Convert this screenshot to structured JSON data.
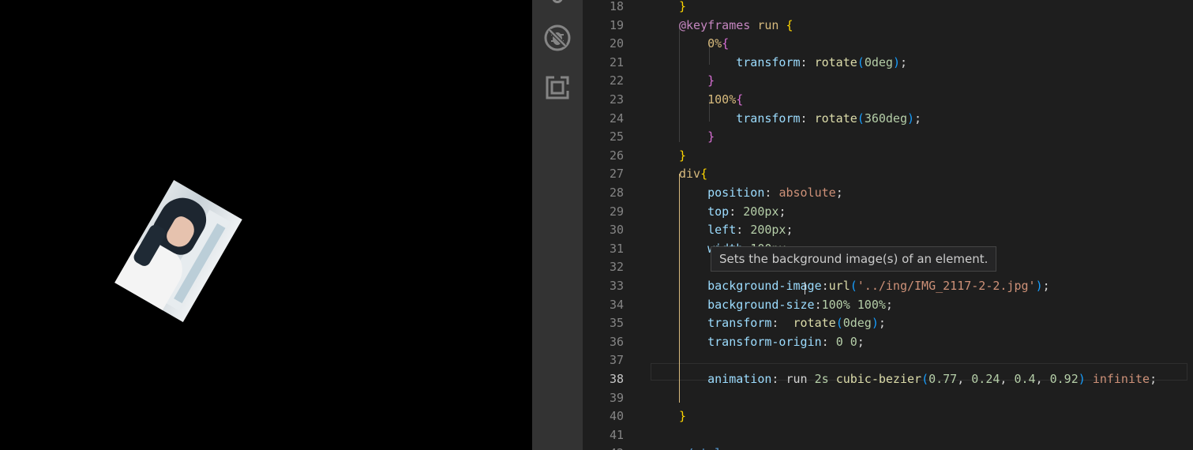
{
  "preview": {
    "image_rotation_deg": 30
  },
  "activity_bar": {
    "icons": [
      "debug-disabled-icon",
      "remote-explorer-icon"
    ]
  },
  "editor": {
    "current_line": 38,
    "lines": [
      {
        "n": "18",
        "tokens": [
          [
            "t-brace1",
            "}"
          ]
        ]
      },
      {
        "n": "19",
        "tokens": [
          [
            "t-kw",
            "@keyframes"
          ],
          [
            "t-plain",
            " "
          ],
          [
            "t-sel",
            "run"
          ],
          [
            "t-plain",
            " "
          ],
          [
            "t-brace1",
            "{"
          ]
        ]
      },
      {
        "n": "20",
        "tokens": [
          [
            "t-plain",
            "    "
          ],
          [
            "t-sel",
            "0%"
          ],
          [
            "t-brace2",
            "{"
          ]
        ]
      },
      {
        "n": "21",
        "tokens": [
          [
            "t-plain",
            "        "
          ],
          [
            "t-prop",
            "transform"
          ],
          [
            "t-plain",
            ": "
          ],
          [
            "t-fn",
            "rotate"
          ],
          [
            "t-brace3",
            "("
          ],
          [
            "t-num",
            "0deg"
          ],
          [
            "t-brace3",
            ")"
          ],
          [
            "t-plain",
            ";"
          ]
        ]
      },
      {
        "n": "22",
        "tokens": [
          [
            "t-plain",
            "    "
          ],
          [
            "t-brace2",
            "}"
          ]
        ]
      },
      {
        "n": "23",
        "tokens": [
          [
            "t-plain",
            "    "
          ],
          [
            "t-sel",
            "100%"
          ],
          [
            "t-brace2",
            "{"
          ]
        ]
      },
      {
        "n": "24",
        "tokens": [
          [
            "t-plain",
            "        "
          ],
          [
            "t-prop",
            "transform"
          ],
          [
            "t-plain",
            ": "
          ],
          [
            "t-fn",
            "rotate"
          ],
          [
            "t-brace3",
            "("
          ],
          [
            "t-num",
            "360deg"
          ],
          [
            "t-brace3",
            ")"
          ],
          [
            "t-plain",
            ";"
          ]
        ]
      },
      {
        "n": "25",
        "tokens": [
          [
            "t-plain",
            "    "
          ],
          [
            "t-brace2",
            "}"
          ]
        ]
      },
      {
        "n": "26",
        "tokens": [
          [
            "t-brace1",
            "}"
          ]
        ]
      },
      {
        "n": "27",
        "tokens": [
          [
            "t-sel",
            "div"
          ],
          [
            "t-brace1",
            "{"
          ]
        ]
      },
      {
        "n": "28",
        "tokens": [
          [
            "t-plain",
            "    "
          ],
          [
            "t-prop",
            "position"
          ],
          [
            "t-plain",
            ": "
          ],
          [
            "t-val",
            "absolute"
          ],
          [
            "t-plain",
            ";"
          ]
        ]
      },
      {
        "n": "29",
        "tokens": [
          [
            "t-plain",
            "    "
          ],
          [
            "t-prop",
            "top"
          ],
          [
            "t-plain",
            ": "
          ],
          [
            "t-num",
            "200px"
          ],
          [
            "t-plain",
            ";"
          ]
        ]
      },
      {
        "n": "30",
        "tokens": [
          [
            "t-plain",
            "    "
          ],
          [
            "t-prop",
            "left"
          ],
          [
            "t-plain",
            ": "
          ],
          [
            "t-num",
            "200px"
          ],
          [
            "t-plain",
            ";"
          ]
        ]
      },
      {
        "n": "31",
        "tokens": [
          [
            "t-plain",
            "    "
          ],
          [
            "t-prop",
            "width"
          ],
          [
            "t-plain",
            ":"
          ],
          [
            "t-num",
            "100px"
          ],
          [
            "t-plain",
            ";"
          ]
        ]
      },
      {
        "n": "32",
        "tokens": []
      },
      {
        "n": "33",
        "tokens": [
          [
            "t-plain",
            "    "
          ],
          [
            "t-prop",
            "background-image"
          ],
          [
            "t-plain",
            ":"
          ],
          [
            "t-fn",
            "url"
          ],
          [
            "t-brace3",
            "("
          ],
          [
            "t-str",
            "'../ing/IMG_2117-2-2.jpg'"
          ],
          [
            "t-brace3",
            ")"
          ],
          [
            "t-plain",
            ";"
          ]
        ]
      },
      {
        "n": "34",
        "tokens": [
          [
            "t-plain",
            "    "
          ],
          [
            "t-prop",
            "background-size"
          ],
          [
            "t-plain",
            ":"
          ],
          [
            "t-num",
            "100%"
          ],
          [
            "t-plain",
            " "
          ],
          [
            "t-num",
            "100%"
          ],
          [
            "t-plain",
            ";"
          ]
        ]
      },
      {
        "n": "35",
        "tokens": [
          [
            "t-plain",
            "    "
          ],
          [
            "t-prop",
            "transform"
          ],
          [
            "t-plain",
            ":  "
          ],
          [
            "t-fn",
            "rotate"
          ],
          [
            "t-brace3",
            "("
          ],
          [
            "t-num",
            "0deg"
          ],
          [
            "t-brace3",
            ")"
          ],
          [
            "t-plain",
            ";"
          ]
        ]
      },
      {
        "n": "36",
        "tokens": [
          [
            "t-plain",
            "    "
          ],
          [
            "t-prop",
            "transform-origin"
          ],
          [
            "t-plain",
            ": "
          ],
          [
            "t-num",
            "0"
          ],
          [
            "t-plain",
            " "
          ],
          [
            "t-num",
            "0"
          ],
          [
            "t-plain",
            ";"
          ]
        ]
      },
      {
        "n": "37",
        "tokens": []
      },
      {
        "n": "38",
        "tokens": [
          [
            "t-plain",
            "    "
          ],
          [
            "t-prop",
            "animation"
          ],
          [
            "t-plain",
            ": "
          ],
          [
            "t-plain",
            "run "
          ],
          [
            "t-num",
            "2s"
          ],
          [
            "t-plain",
            " "
          ],
          [
            "t-fn",
            "cubic-bezier"
          ],
          [
            "t-brace3",
            "("
          ],
          [
            "t-num",
            "0.77"
          ],
          [
            "t-plain",
            ", "
          ],
          [
            "t-num",
            "0.24"
          ],
          [
            "t-plain",
            ", "
          ],
          [
            "t-num",
            "0.4"
          ],
          [
            "t-plain",
            ", "
          ],
          [
            "t-num",
            "0.92"
          ],
          [
            "t-brace3",
            ")"
          ],
          [
            "t-plain",
            " "
          ],
          [
            "t-val",
            "infinite"
          ],
          [
            "t-plain",
            ";"
          ]
        ]
      },
      {
        "n": "39",
        "tokens": []
      },
      {
        "n": "40",
        "tokens": [
          [
            "t-brace1",
            "}"
          ]
        ]
      },
      {
        "n": "41",
        "tokens": []
      },
      {
        "n": "42",
        "tokens": [
          [
            "t-tag",
            "</style>"
          ]
        ]
      }
    ]
  },
  "hover_tooltip": {
    "text": "Sets the background image(s) of an element."
  }
}
